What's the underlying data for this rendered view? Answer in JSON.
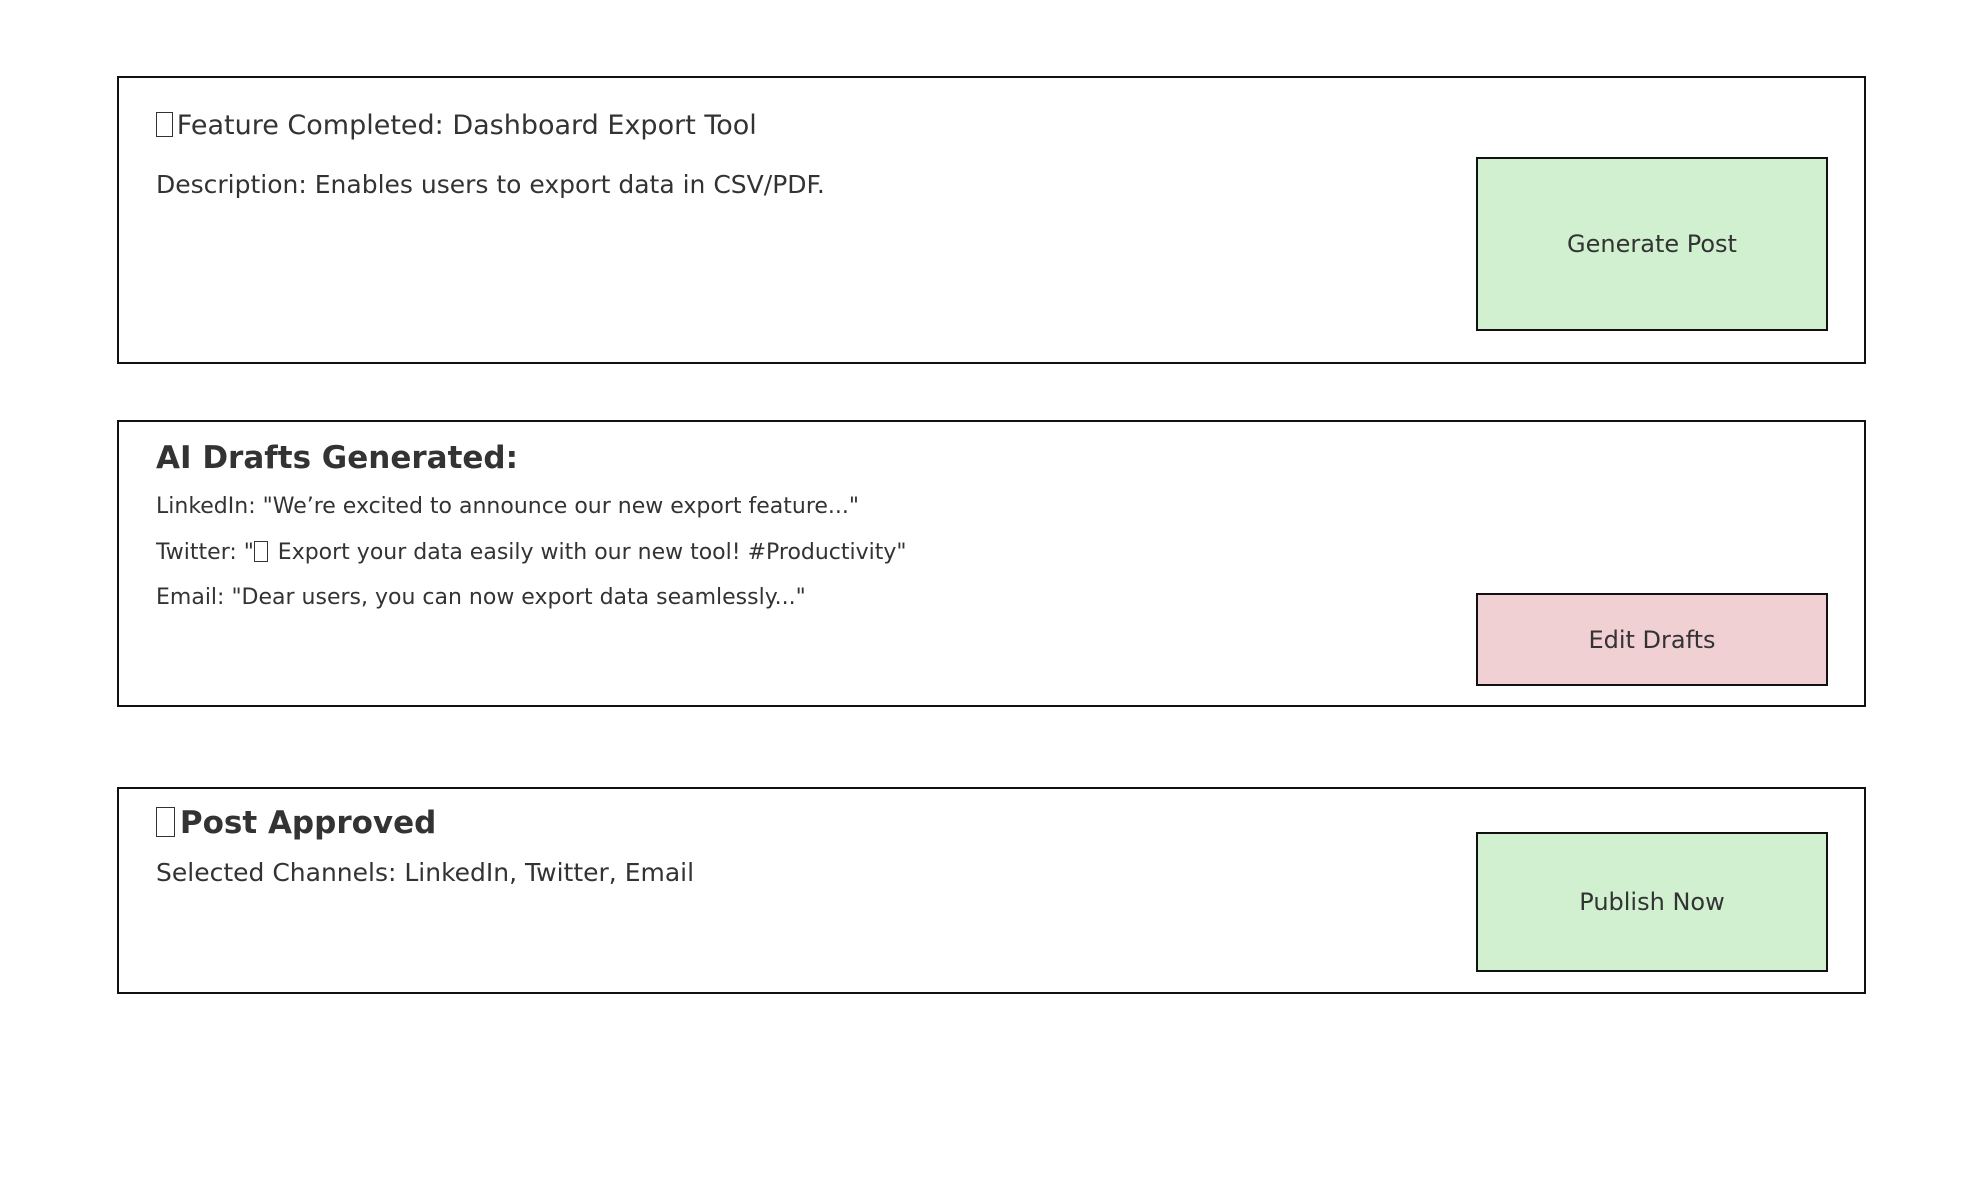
{
  "feature_card": {
    "title": "Feature Completed: Dashboard Export Tool",
    "title_icon": "missing-glyph-icon",
    "description": "Description: Enables users to export data in CSV/PDF.",
    "button_label": "Generate Post",
    "button_color": "#d1f0d0"
  },
  "drafts_card": {
    "title": "AI Drafts Generated:",
    "drafts": [
      {
        "text": "LinkedIn: \"We’re excited to announce our new export feature...\""
      },
      {
        "prefix": "Twitter: \"",
        "icon": "missing-glyph-icon",
        "suffix": " Export your data easily with our new tool! #Productivity\""
      },
      {
        "text": "Email: \"Dear users, you can now export data seamlessly...\""
      }
    ],
    "button_label": "Edit Drafts",
    "button_color": "#f0d0d3"
  },
  "approved_card": {
    "title": "Post Approved",
    "title_icon": "missing-glyph-icon",
    "channels": "Selected Channels: LinkedIn, Twitter, Email",
    "button_label": "Publish Now",
    "button_color": "#d1f0d0"
  }
}
